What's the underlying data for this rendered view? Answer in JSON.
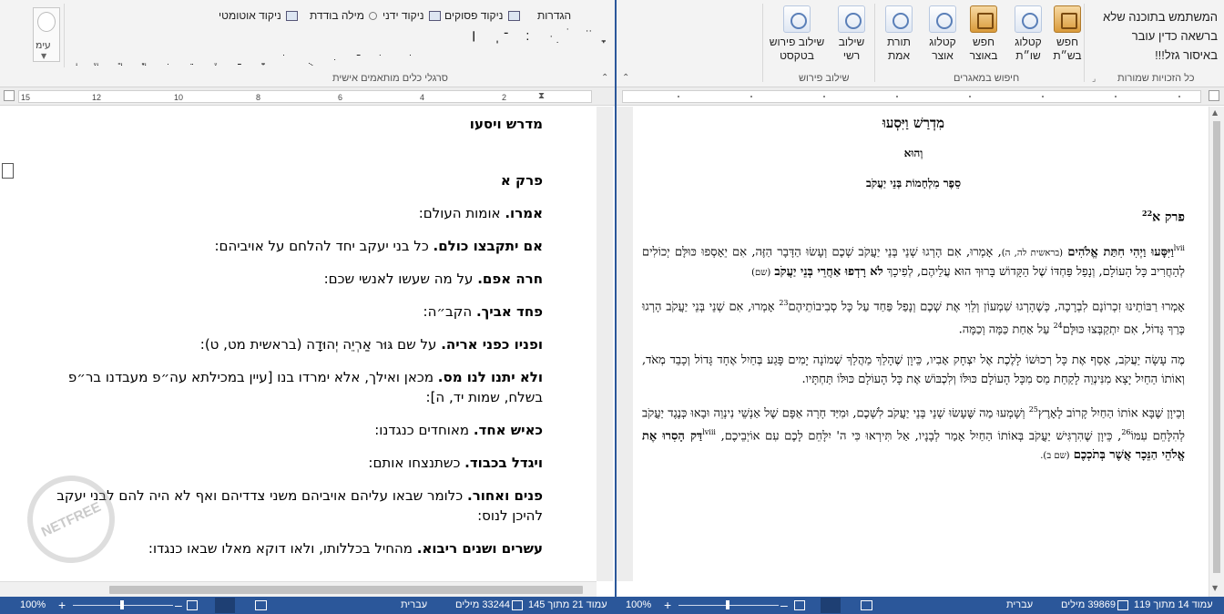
{
  "left_window": {
    "ribbon": {
      "punct_pesukim": "ניקוד פסוקים",
      "hagdarot": "הגדרות",
      "nikud_yadani": "ניקוד ידני",
      "mila_bodedet": "מילה בודדת",
      "nikud_automati": "ניקוד אוטומטי",
      "group_label": "סרגלי כלים מותאמים אישית",
      "style_label": "עימ",
      "row1_glyphs": "ׇ ׂ ׁ ׄ ׅ ּ ׃ ־ ֽ ׀",
      "row2_glyphs": "ְ ֱ ֲ ֳ ִ ֵ ֶ ַ ָ ֹ ֻ ּ ֿ ׂ ׁ"
    },
    "ruler_numbers": [
      "2",
      "4",
      "6",
      "8",
      "10",
      "12",
      "15"
    ],
    "document": {
      "title": "מדרש ויסעו",
      "chapter": "פרק א",
      "paragraphs": [
        {
          "bold": "אמרו.",
          "text": " אומות העולם:"
        },
        {
          "bold": "אם יתקבצו כולם.",
          "text": " כל בני יעקב יחד להלחם על אויביהם:"
        },
        {
          "bold": "חרה אפם.",
          "text": " על מה שעשו לאנשי שכם:"
        },
        {
          "bold": "פחד אביך.",
          "text": " הקב״ה:"
        },
        {
          "bold": "ופניו כפני אריה.",
          "text": " על שם גּוּר אַרְיֵה יְהוּדָה (בראשית מט, ט):"
        },
        {
          "bold": "ולא יתנו לנו מס.",
          "text": " מכאן ואילך, אלא ימרדו בנו [עיין במכילתא עה״פ מעבדנו בר״פ בשלח, שמות יד, ה]:"
        },
        {
          "bold": "כאיש אחד.",
          "text": " מאוחדים כנגדנו:"
        },
        {
          "bold": "ויגדל בכבוד.",
          "text": " כשתנצחו אותם:"
        },
        {
          "bold": "פנים ואחור.",
          "text": " כלומר שבאו עליהם אויביהם משני צדדיהם ואף לא היה להם לבני יעקב להיכן לנוס:"
        },
        {
          "bold": "עשרים ושנים ריבוא.",
          "text": " מהחיל בכללותו, ולאו דוקא מאלו שבאו כנגדו:"
        }
      ]
    },
    "watermark": "NETFREE",
    "status": {
      "page": "עמוד 21 מתוך 145",
      "words": "33244 מילים",
      "language": "עברית",
      "zoom": "100%"
    }
  },
  "right_window": {
    "ribbon": {
      "items": [
        {
          "label": "חפש בש״ת",
          "icon": "book"
        },
        {
          "label": "קטלוג שו״ת",
          "icon": "search"
        },
        {
          "label": "חפש באוצר",
          "icon": "book"
        },
        {
          "label": "קטלוג אוצר",
          "icon": "search"
        },
        {
          "label": "תורת אמת",
          "icon": "search"
        },
        {
          "label": "שילוב רשי",
          "icon": "search"
        },
        {
          "label": "שילוב פירוש בטקסט",
          "icon": "search"
        }
      ],
      "group_copyright": "כל הזכויות שמורות",
      "group_search": "חיפוש במאגרים",
      "group_combine": "שילוב פירוש",
      "user_lines": [
        "המשתמש בתוכנה שלא",
        "ברשאה כדין עובר",
        "באיסור גזל!!!"
      ]
    },
    "document": {
      "title": "מִדְרַשׁ וַיִּסְעוּ",
      "subtitle": "וְהוּא",
      "book": "סֵפֶר מִלְחָמוֹת בְּנֵי יַעֲקֹב",
      "chapter": "פרק א",
      "chapter_note": "22",
      "p1_marker": "lvii",
      "p1_bold": "וַיִּסָּעוּ וַיְהִי חִתַּת אֱלֹהִים",
      "p1_src": "(בראשית לה, ה)",
      "p1_text": ", אָמְרוּ, אִם הָרְגוּ שְׁנֵי בְּנֵי יַעֲקֹב שְׁכֶם וְעָשׂוּ הַדָּבָר הַזֶּה, אִם יֵאָסְפוּ כּוּלָּם יְכוֹלִים לְהַחֲרִיב כָּל הָעוֹלָם, וְנָפַל פַּחְדּוֹ שֶׁל הַקָּדוֹשׁ בָּרוּךְ הוּא עֲלֵיהֶם, לְפִיכָךְ ",
      "p1_bold2": "לֹא רָדְפוּ אַחֲרֵי בְּנֵי יַעֲקֹב",
      "p1_src2": "(שם)",
      "p2_text": "אָמְרוּ רַבּוֹתֵינוּ זִכְרוֹנָם לִבְרָכָה, כְּשֶׁהָרְגוּ שִׁמְעוֹן וְלֵוִי אֶת שְׁכֶם וְנָפַל פַּחַד עַל כָּל סְבִיבוֹתֵיהֶם",
      "p2_note": "23",
      "p2_text2": " אָמְרוּ, אִם שְׁנֵי בְּנֵי יַעֲקֹב הָרְגוּ כְּרַךְ גָּדוֹל, אִם יִתְקַבְּצוּ כּוּלָּם",
      "p2_note2": "24",
      "p2_text3": " עַל אַחַת כַּמָּה וְכַמָּה.",
      "p3_text": "מֶה עָשָׂה יַעֲקֹב, אָסַף אֶת כָּל רְכוּשׁוֹ לָלֶכֶת אֶל יִצְחָק אָבִיו, כֵּיוָן שֶׁהָלַךְ מַהֲלַךְ שְׁמוֹנָה יָמִים פָּגַע בְּחַיִל אֶחָד גָּדוֹל וְכָבֵד מְאֹד, וְאוֹתוֹ הַחַיִל יָצָא מִנִּינְוֵה לָקַחַת מַס מִכָּל הָעוֹלָם כּוּלּוֹ וְלִכְבּוֹשׁ אֶת כָּל הָעוֹלָם כּוּלּוֹ תַּחְתָּיו.",
      "p4_text": "וְכֵיוָן שֶׁבָּא אוֹתוֹ הַחַיִל קָרוֹב לָאָרֶץ",
      "p4_note": "25",
      "p4_text2": " וְשָׁמְעוּ מַה שֶּׁעָשׂוּ שְׁנֵי בְּנֵי יַעֲקֹב לִשְׁכֶם, וּמִיַּד חָרָה אַפָּם שֶׁל אַנְשֵׁי נִינְוֵה וּבָאוּ כְּנֶגֶד יַעֲקֹב לְהִלָּחֵם עִמּוֹ",
      "p4_note2": "26",
      "p4_text3": ", כֵּיוָן שֶׁהִרְגִּישׁ יַעֲקֹב בְּאוֹתוֹ הַחַיִל אָמַר לְבָנָיו, אַל תִּירְאוּ כִּי ה' יִלָּחֵם לָכֶם עִם אוֹיְבֵיכֶם,",
      "p4_marker": "lviii",
      "p4_bold": "דַּק הָסִרוּ אֶת אֱלֹהֵי הַנֵּכָר אֲשֶׁר בְּתֹכְכֶם",
      "p4_src": "(שם ב)."
    },
    "status": {
      "page": "עמוד 14 מתוך 119",
      "words": "39869 מילים",
      "language": "עברית",
      "zoom": "100%"
    }
  },
  "colors": {
    "statusbar": "#2b579a",
    "ribbon": "#f3f3f3"
  }
}
